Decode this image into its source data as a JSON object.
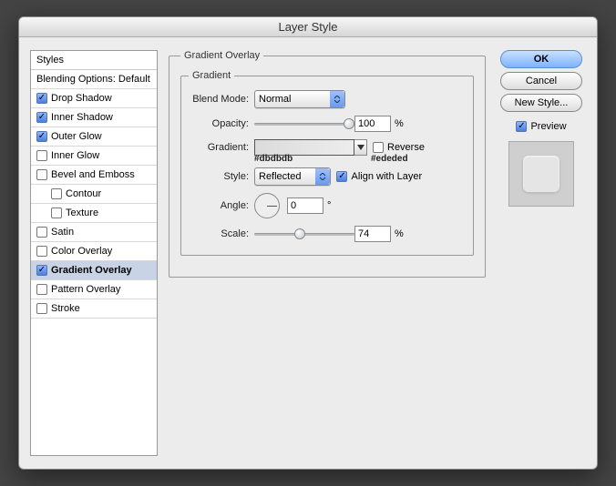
{
  "window": {
    "title": "Layer Style"
  },
  "sidebar": {
    "header": "Styles",
    "blending": "Blending Options: Default",
    "items": [
      {
        "label": "Drop Shadow",
        "checked": true
      },
      {
        "label": "Inner Shadow",
        "checked": true
      },
      {
        "label": "Outer Glow",
        "checked": true
      },
      {
        "label": "Inner Glow",
        "checked": false
      },
      {
        "label": "Bevel and Emboss",
        "checked": false
      },
      {
        "label": "Contour",
        "checked": false,
        "sub": true
      },
      {
        "label": "Texture",
        "checked": false,
        "sub": true
      },
      {
        "label": "Satin",
        "checked": false
      },
      {
        "label": "Color Overlay",
        "checked": false
      },
      {
        "label": "Gradient Overlay",
        "checked": true,
        "selected": true
      },
      {
        "label": "Pattern Overlay",
        "checked": false
      },
      {
        "label": "Stroke",
        "checked": false
      }
    ]
  },
  "panel": {
    "title": "Gradient Overlay",
    "section": "Gradient",
    "blendModeLabel": "Blend Mode:",
    "blendMode": "Normal",
    "opacityLabel": "Opacity:",
    "opacityValue": "100",
    "opacityUnit": "%",
    "gradientLabel": "Gradient:",
    "gradHexLeft": "#dbdbdb",
    "gradHexRight": "#ededed",
    "reverseLabel": "Reverse",
    "styleLabel": "Style:",
    "styleValue": "Reflected",
    "alignLabel": "Align with Layer",
    "angleLabel": "Angle:",
    "angleValue": "0",
    "angleUnit": "°",
    "scaleLabel": "Scale:",
    "scaleValue": "74",
    "scaleUnit": "%"
  },
  "buttons": {
    "ok": "OK",
    "cancel": "Cancel",
    "newStyle": "New Style...",
    "preview": "Preview"
  }
}
